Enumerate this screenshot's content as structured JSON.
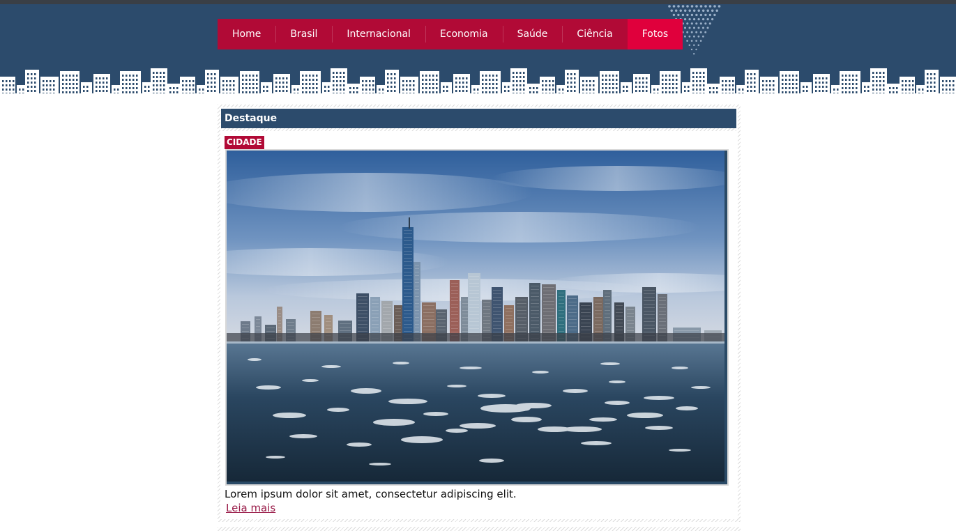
{
  "nav": {
    "items": [
      {
        "label": "Home"
      },
      {
        "label": "Brasil"
      },
      {
        "label": "Internacional"
      },
      {
        "label": "Economia"
      },
      {
        "label": "Saúde"
      },
      {
        "label": "Ciência"
      },
      {
        "label": "Fotos"
      }
    ],
    "active_index": 6
  },
  "featured": {
    "title": "Destaque",
    "badge": "CIDADE",
    "caption": "Lorem ipsum dolor sit amet, consectetur adipiscing elit.",
    "read_more": "Leia mais"
  },
  "colors": {
    "header_bg": "#2c4b6c",
    "nav_bg": "#b10a36",
    "nav_active": "#e0003c",
    "link": "#9a1d4a"
  }
}
